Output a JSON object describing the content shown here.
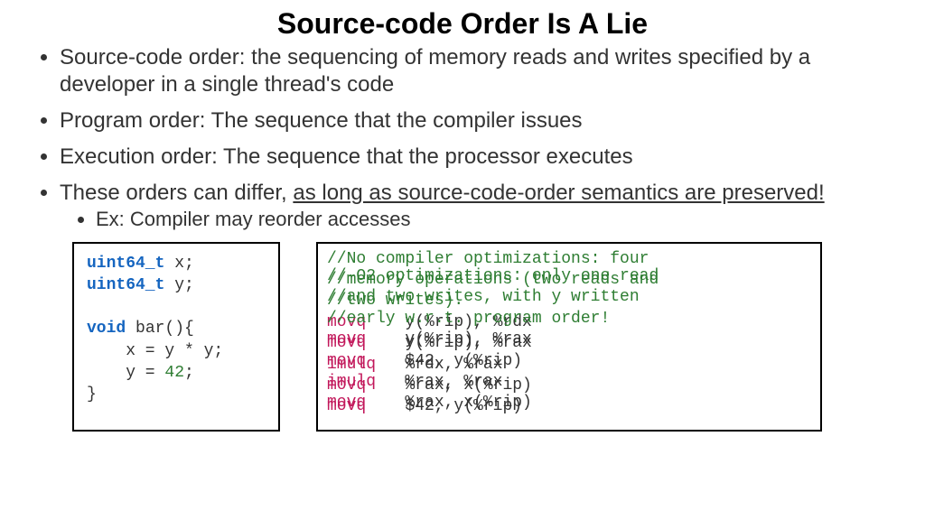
{
  "title": "Source-code Order Is A Lie",
  "bullets": {
    "b1": "Source-code order: the sequencing of memory reads and writes specified by a developer in a single thread's code",
    "b2": "Program order: The sequence that the compiler issues",
    "b3": "Execution order: The sequence that the processor executes",
    "b4a": "These orders can differ, ",
    "b4b": "as long as source-code-order semantics are preserved!",
    "sub1": "Ex: Compiler may reorder accesses"
  },
  "codeLeft": {
    "l1a": "uint64_t",
    "l1b": " x;",
    "l2a": "uint64_t",
    "l2b": " y;",
    "l3": "",
    "l4a": "void",
    "l4b": " bar(){",
    "l5a": "    x = y * y;",
    "l6a": "    y = ",
    "l6b": "42",
    "l6c": ";",
    "l7": "}"
  },
  "asmA": {
    "c1": "//No compiler optimizations: four",
    "c2": "//memory operations (two reads and",
    "c3": "//two writes).",
    "i1": "movq",
    "a1": "    y(%rip), %rdx",
    "i2": "movq",
    "a2": "    y(%rip), %rax",
    "i3": "imulq",
    "a3": "   %rdx, %rax",
    "i4": "movq",
    "a4": "    %rax, x(%rip)",
    "i5": "movq",
    "a5": "    $42, y(%rip)"
  },
  "asmB": {
    "c1": "//-O2 optimizations: only one read",
    "c2": "//and two writes, with y written",
    "c3": "//early w.r.t. program order!",
    "i1": "movq",
    "a1": "    y(%rip), %rax",
    "i2": "movq",
    "a2": "    $42, y(%rip)",
    "i3": "imulq",
    "a3": "   %rax, %rax",
    "i4": "movq",
    "a4": "    %rax, x(%rip)"
  }
}
